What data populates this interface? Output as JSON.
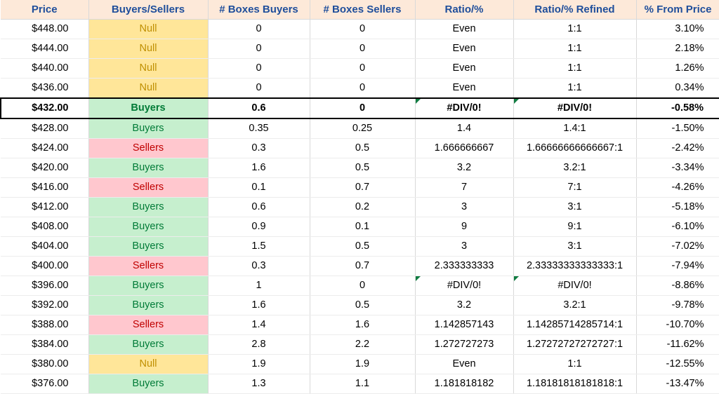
{
  "headers": {
    "price": "Price",
    "bs": "Buyers/Sellers",
    "boxBuyers": "# Boxes Buyers",
    "boxSellers": "# Boxes Sellers",
    "ratio": "Ratio/%",
    "ratioRef": "Ratio/% Refined",
    "fromPrice": "% From Price"
  },
  "rows": [
    {
      "price": "$448.00",
      "bs": "Null",
      "boxB": "0",
      "boxS": "0",
      "ratio": "Even",
      "ratioRef": "1:1",
      "pct": "3.10%"
    },
    {
      "price": "$444.00",
      "bs": "Null",
      "boxB": "0",
      "boxS": "0",
      "ratio": "Even",
      "ratioRef": "1:1",
      "pct": "2.18%"
    },
    {
      "price": "$440.00",
      "bs": "Null",
      "boxB": "0",
      "boxS": "0",
      "ratio": "Even",
      "ratioRef": "1:1",
      "pct": "1.26%"
    },
    {
      "price": "$436.00",
      "bs": "Null",
      "boxB": "0",
      "boxS": "0",
      "ratio": "Even",
      "ratioRef": "1:1",
      "pct": "0.34%"
    },
    {
      "price": "$432.00",
      "bs": "Buyers",
      "boxB": "0.6",
      "boxS": "0",
      "ratio": "#DIV/0!",
      "ratioRef": "#DIV/0!",
      "pct": "-0.58%",
      "hot": true,
      "err": true
    },
    {
      "price": "$428.00",
      "bs": "Buyers",
      "boxB": "0.35",
      "boxS": "0.25",
      "ratio": "1.4",
      "ratioRef": "1.4:1",
      "pct": "-1.50%"
    },
    {
      "price": "$424.00",
      "bs": "Sellers",
      "boxB": "0.3",
      "boxS": "0.5",
      "ratio": "1.666666667",
      "ratioRef": "1.66666666666667:1",
      "pct": "-2.42%"
    },
    {
      "price": "$420.00",
      "bs": "Buyers",
      "boxB": "1.6",
      "boxS": "0.5",
      "ratio": "3.2",
      "ratioRef": "3.2:1",
      "pct": "-3.34%"
    },
    {
      "price": "$416.00",
      "bs": "Sellers",
      "boxB": "0.1",
      "boxS": "0.7",
      "ratio": "7",
      "ratioRef": "7:1",
      "pct": "-4.26%"
    },
    {
      "price": "$412.00",
      "bs": "Buyers",
      "boxB": "0.6",
      "boxS": "0.2",
      "ratio": "3",
      "ratioRef": "3:1",
      "pct": "-5.18%"
    },
    {
      "price": "$408.00",
      "bs": "Buyers",
      "boxB": "0.9",
      "boxS": "0.1",
      "ratio": "9",
      "ratioRef": "9:1",
      "pct": "-6.10%"
    },
    {
      "price": "$404.00",
      "bs": "Buyers",
      "boxB": "1.5",
      "boxS": "0.5",
      "ratio": "3",
      "ratioRef": "3:1",
      "pct": "-7.02%"
    },
    {
      "price": "$400.00",
      "bs": "Sellers",
      "boxB": "0.3",
      "boxS": "0.7",
      "ratio": "2.333333333",
      "ratioRef": "2.33333333333333:1",
      "pct": "-7.94%"
    },
    {
      "price": "$396.00",
      "bs": "Buyers",
      "boxB": "1",
      "boxS": "0",
      "ratio": "#DIV/0!",
      "ratioRef": "#DIV/0!",
      "pct": "-8.86%",
      "err": true
    },
    {
      "price": "$392.00",
      "bs": "Buyers",
      "boxB": "1.6",
      "boxS": "0.5",
      "ratio": "3.2",
      "ratioRef": "3.2:1",
      "pct": "-9.78%"
    },
    {
      "price": "$388.00",
      "bs": "Sellers",
      "boxB": "1.4",
      "boxS": "1.6",
      "ratio": "1.142857143",
      "ratioRef": "1.14285714285714:1",
      "pct": "-10.70%"
    },
    {
      "price": "$384.00",
      "bs": "Buyers",
      "boxB": "2.8",
      "boxS": "2.2",
      "ratio": "1.272727273",
      "ratioRef": "1.27272727272727:1",
      "pct": "-11.62%"
    },
    {
      "price": "$380.00",
      "bs": "Null",
      "boxB": "1.9",
      "boxS": "1.9",
      "ratio": "Even",
      "ratioRef": "1:1",
      "pct": "-12.55%"
    },
    {
      "price": "$376.00",
      "bs": "Buyers",
      "boxB": "1.3",
      "boxS": "1.1",
      "ratio": "1.181818182",
      "ratioRef": "1.18181818181818:1",
      "pct": "-13.47%"
    }
  ]
}
